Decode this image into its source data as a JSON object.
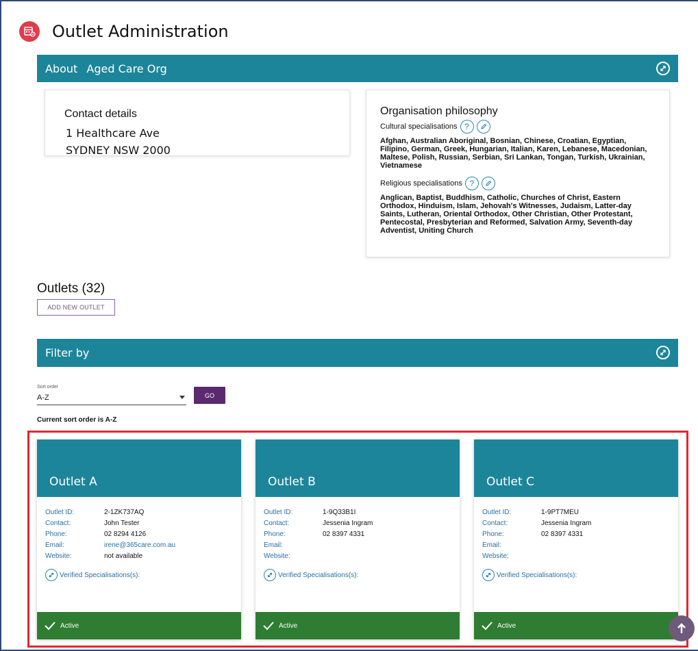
{
  "app": {
    "title": "Outlet Administration",
    "logo_icon": "calendar-gear-icon",
    "accent": "#1c8599",
    "brand": "#e03c4e"
  },
  "about": {
    "prefix": "About",
    "org_name": "Aged Care Org"
  },
  "contact": {
    "heading": "Contact details",
    "address_line1": "1 Healthcare Ave",
    "address_line2": "SYDNEY NSW 2000"
  },
  "philosophy": {
    "heading": "Organisation philosophy",
    "cultural_label": "Cultural specialisations",
    "cultural_text": "Afghan, Australian Aboriginal, Bosnian, Chinese, Croatian, Egyptian, Filipino, German, Greek, Hungarian, Italian, Karen, Lebanese, Macedonian, Maltese, Polish, Russian, Serbian, Sri Lankan, Tongan, Turkish, Ukrainian, Vietnamese",
    "religious_label": "Religious specialisations",
    "religious_text": "Anglican, Baptist, Buddhism, Catholic, Churches of Christ, Eastern Orthodox, Hinduism, Islam, Jehovah's Witnesses, Judaism, Latter-day Saints, Lutheran, Oriental Orthodox, Other Christian, Other Protestant, Pentecostal, Presbyterian and Reformed, Salvation Army, Seventh-day Adventist, Uniting Church",
    "help_glyph": "?"
  },
  "outlets": {
    "heading": "Outlets (32)",
    "add_button": "ADD NEW OUTLET"
  },
  "filter": {
    "title": "Filter by",
    "sort_label": "Sort order",
    "sort_value": "A-Z",
    "go_button": "GO",
    "status": "Current sort order is A-Z"
  },
  "card_labels": {
    "id": "Outlet ID:",
    "contact": "Contact:",
    "phone": "Phone:",
    "email": "Email:",
    "website": "Website:",
    "verified": "Verified Specialisations(s):",
    "status": "Active"
  },
  "cards": [
    {
      "name": "Outlet A",
      "id": "2-1ZK737AQ",
      "contact": "John Tester",
      "phone": "02 8294 4126",
      "email": "irene@365care.com.au",
      "website": "not available"
    },
    {
      "name": "Outlet B",
      "id": "1-9Q33B1I",
      "contact": "Jessenia Ingram",
      "phone": "02 8397 4331",
      "email": "",
      "website": ""
    },
    {
      "name": "Outlet C",
      "id": "1-9PT7MEU",
      "contact": "Jessenia Ingram",
      "phone": "02 8397 4331",
      "email": "",
      "website": ""
    }
  ]
}
